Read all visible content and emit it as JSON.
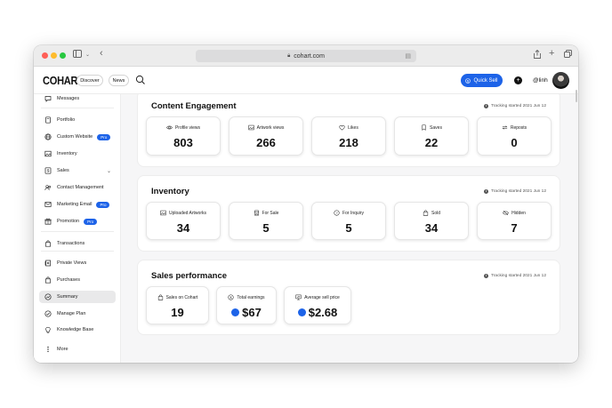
{
  "browser": {
    "url": "cohart.com"
  },
  "header": {
    "logo": "COHART",
    "nav_pills": [
      "Discover",
      "News"
    ],
    "quick_sell_label": "Quick Sell",
    "user_handle": "@linh",
    "accent_color": "#1d63e8"
  },
  "sidebar": {
    "items": [
      {
        "label": "Messages",
        "icon": "messages-icon"
      },
      {
        "label": "Portfolio",
        "icon": "portfolio-icon"
      },
      {
        "label": "Custom Website",
        "icon": "globe-icon",
        "badge": "Pro"
      },
      {
        "label": "Inventory",
        "icon": "inventory-icon"
      },
      {
        "label": "Sales",
        "icon": "dollar-icon",
        "expandable": true
      },
      {
        "label": "Contact Management",
        "icon": "contacts-icon"
      },
      {
        "label": "Marketing Email",
        "icon": "mail-icon",
        "badge": "Pro"
      },
      {
        "label": "Promotion",
        "icon": "gift-icon",
        "badge": "Pro"
      },
      {
        "label": "Transactions",
        "icon": "bag-icon"
      },
      {
        "label": "Private Views",
        "icon": "private-views-icon"
      },
      {
        "label": "Purchases",
        "icon": "purchases-icon"
      },
      {
        "label": "Summary",
        "icon": "summary-icon",
        "active": true
      },
      {
        "label": "Manage Plan",
        "icon": "check-circle-icon"
      },
      {
        "label": "Knowledge Base",
        "icon": "bulb-icon"
      },
      {
        "label": "More",
        "icon": "more-icon"
      }
    ]
  },
  "sections": {
    "engagement": {
      "title": "Content Engagement",
      "tracking": "Tracking started 2021 Jun 12",
      "cards": [
        {
          "label": "Profile views",
          "value": "803",
          "icon": "eye-icon"
        },
        {
          "label": "Artwork views",
          "value": "266",
          "icon": "image-icon"
        },
        {
          "label": "Likes",
          "value": "218",
          "icon": "heart-icon"
        },
        {
          "label": "Saves",
          "value": "22",
          "icon": "bookmark-icon"
        },
        {
          "label": "Reposts",
          "value": "0",
          "icon": "repost-icon"
        }
      ]
    },
    "inventory": {
      "title": "Inventory",
      "tracking": "Tracking started 2021 Jun 12",
      "cards": [
        {
          "label": "Uploaded Artworks",
          "value": "34",
          "icon": "image-icon"
        },
        {
          "label": "For Sale",
          "value": "5",
          "icon": "store-icon"
        },
        {
          "label": "For Inquiry",
          "value": "5",
          "icon": "question-icon"
        },
        {
          "label": "Sold",
          "value": "34",
          "icon": "bag-icon"
        },
        {
          "label": "Hidden",
          "value": "7",
          "icon": "eye-off-icon"
        }
      ]
    },
    "sales": {
      "title": "Sales performance",
      "tracking": "Tracking started 2021 Jun 12",
      "cards": [
        {
          "label": "Sales on Cohart",
          "value": "19",
          "icon": "bag-icon"
        },
        {
          "label": "Total earnings",
          "value": "$67",
          "icon": "dollar-icon"
        },
        {
          "label": "Average sell price",
          "value": "$2.68",
          "icon": "price-icon"
        }
      ]
    }
  }
}
